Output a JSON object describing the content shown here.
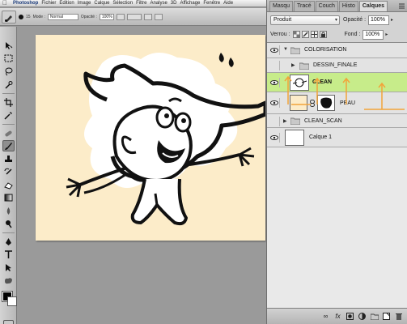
{
  "menubar": {
    "items": [
      "Photoshop",
      "Fichier",
      "Edition",
      "Image",
      "Calque",
      "Sélection",
      "Filtre",
      "Analyse",
      "3D",
      "Affichage",
      "Fenêtre",
      "Aide"
    ]
  },
  "options": {
    "brush_size": "15",
    "mode_label": "Mode :",
    "mode_value": "Normal",
    "opacity_label": "Opacité :",
    "opacity_value": "100%"
  },
  "panel": {
    "tabs": [
      "Masqu",
      "Tracé",
      "Couch",
      "Histo",
      "Calques"
    ],
    "blend_mode": "Produit",
    "opacity_label": "Opacité :",
    "opacity_value": "100%",
    "lock_label": "Verrou :",
    "fill_label": "Fond :",
    "fill_value": "100%",
    "layers": [
      {
        "name": "COLORISATION",
        "kind": "group-open"
      },
      {
        "name": "DESSIN_FINALE",
        "kind": "group-closed"
      },
      {
        "name": "CLEAN",
        "kind": "layer-selected"
      },
      {
        "name": "PEAU",
        "kind": "layer-mask"
      },
      {
        "name": "CLEAN_SCAN",
        "kind": "group-closed"
      },
      {
        "name": "Calque 1",
        "kind": "layer"
      }
    ]
  },
  "colors": {
    "selected_layer": "#c7ec8a",
    "canvas_bg": "#fcecc9",
    "annotation_orange": "#f2a43a"
  },
  "icons": [
    "move-icon",
    "marquee-icon",
    "lasso-icon",
    "quick-select-icon",
    "crop-icon",
    "eyedropper-icon",
    "healing-icon",
    "brush-icon",
    "stamp-icon",
    "history-brush-icon",
    "eraser-icon",
    "gradient-icon",
    "blur-icon",
    "dodge-icon",
    "pen-icon",
    "type-icon",
    "path-select-icon",
    "shape-icon",
    "hand-icon",
    "zoom-icon"
  ]
}
